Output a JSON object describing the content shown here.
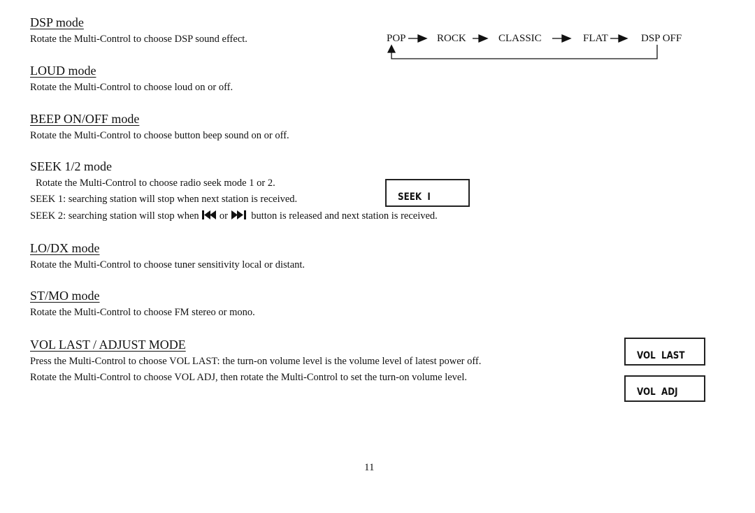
{
  "page_number": "11",
  "sections": {
    "dsp": {
      "title": "DSP mode",
      "body": "Rotate the Multi-Control to choose DSP sound effect.",
      "flow": [
        "POP",
        "ROCK",
        "CLASSIC",
        "FLAT",
        "DSP OFF"
      ]
    },
    "loud": {
      "title": "LOUD mode",
      "body": "Rotate the Multi-Control to choose loud on or off."
    },
    "beep": {
      "title": "BEEP ON/OFF mode",
      "body": "Rotate the Multi-Control to choose button beep sound on or off."
    },
    "seek": {
      "title": "SEEK 1/2 mode",
      "line1": "Rotate the Multi-Control to choose radio seek mode 1 or 2.",
      "line2": "SEEK 1: searching station will stop when next station is received.",
      "line3_a": "SEEK 2: searching station will stop when",
      "line3_or": "or",
      "line3_b": "button is released and next station is received.",
      "display": "SEEK  I",
      "icon_prev": "skip-back-icon",
      "icon_next": "skip-forward-icon"
    },
    "lodx": {
      "title": "LO/DX mode",
      "body": "Rotate the Multi-Control to choose tuner sensitivity local or distant."
    },
    "stmo": {
      "title": "ST/MO mode",
      "body": "Rotate the Multi-Control to choose FM stereo or mono."
    },
    "vol": {
      "title": "VOL LAST / ADJUST MODE",
      "line1": "Press the Multi-Control to choose VOL LAST: the turn-on volume level is the volume level of latest power off.",
      "line2": "Rotate the Multi-Control to choose VOL ADJ, then rotate the Multi-Control to set the turn-on volume level.",
      "display_last": "VOL  LAST",
      "display_adj": "VOL  ADJ"
    }
  }
}
